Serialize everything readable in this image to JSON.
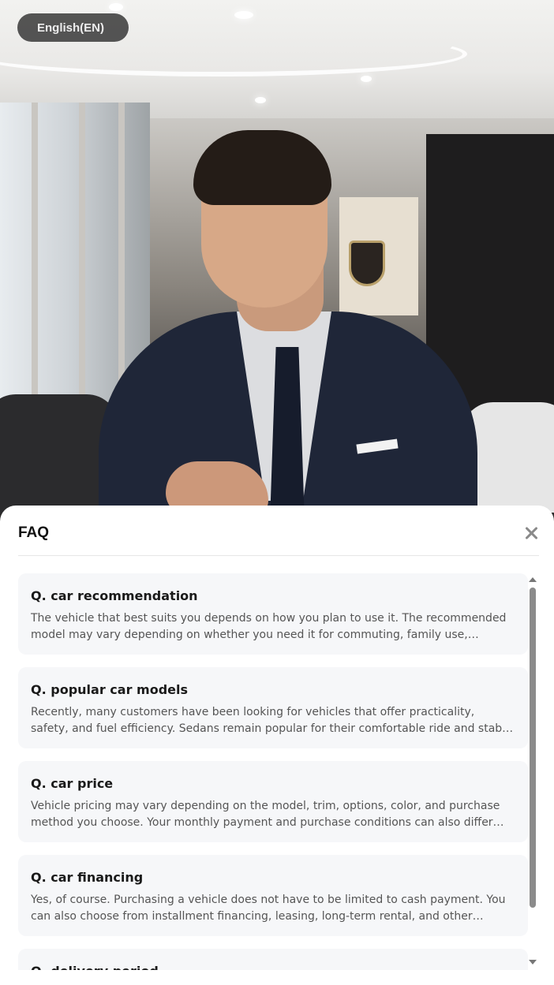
{
  "language_button": {
    "label": "English(EN)"
  },
  "faq": {
    "title": "FAQ",
    "items": [
      {
        "question": "Q. car recommendation",
        "answer": "The vehicle that best suits you depends on how you plan to use it. The recommended model may vary depending on whether you need it for commuting, family use, frequent…"
      },
      {
        "question": "Q. popular car models",
        "answer": "Recently, many customers have been looking for vehicles that offer practicality, safety, and fuel efficiency. Sedans remain popular for their comfortable ride and stable driving…"
      },
      {
        "question": "Q. car price",
        "answer": "Vehicle pricing may vary depending on the model, trim, options, color, and purchase method you choose. Your monthly payment and purchase conditions can also differ…"
      },
      {
        "question": "Q. car financing",
        "answer": "Yes, of course. Purchasing a vehicle does not have to be limited to cash payment. You can also choose from installment financing, leasing, long-term rental, and other purchase…"
      },
      {
        "question": "Q. delivery period",
        "answer": ""
      }
    ]
  },
  "icons": {
    "close": "close-icon",
    "scroll_up": "scroll-up-arrow-icon",
    "scroll_down": "scroll-down-arrow-icon"
  },
  "colors": {
    "sheet_bg": "#ffffff",
    "card_bg": "#f6f7f9",
    "scrollbar": "#8b8b8b"
  }
}
